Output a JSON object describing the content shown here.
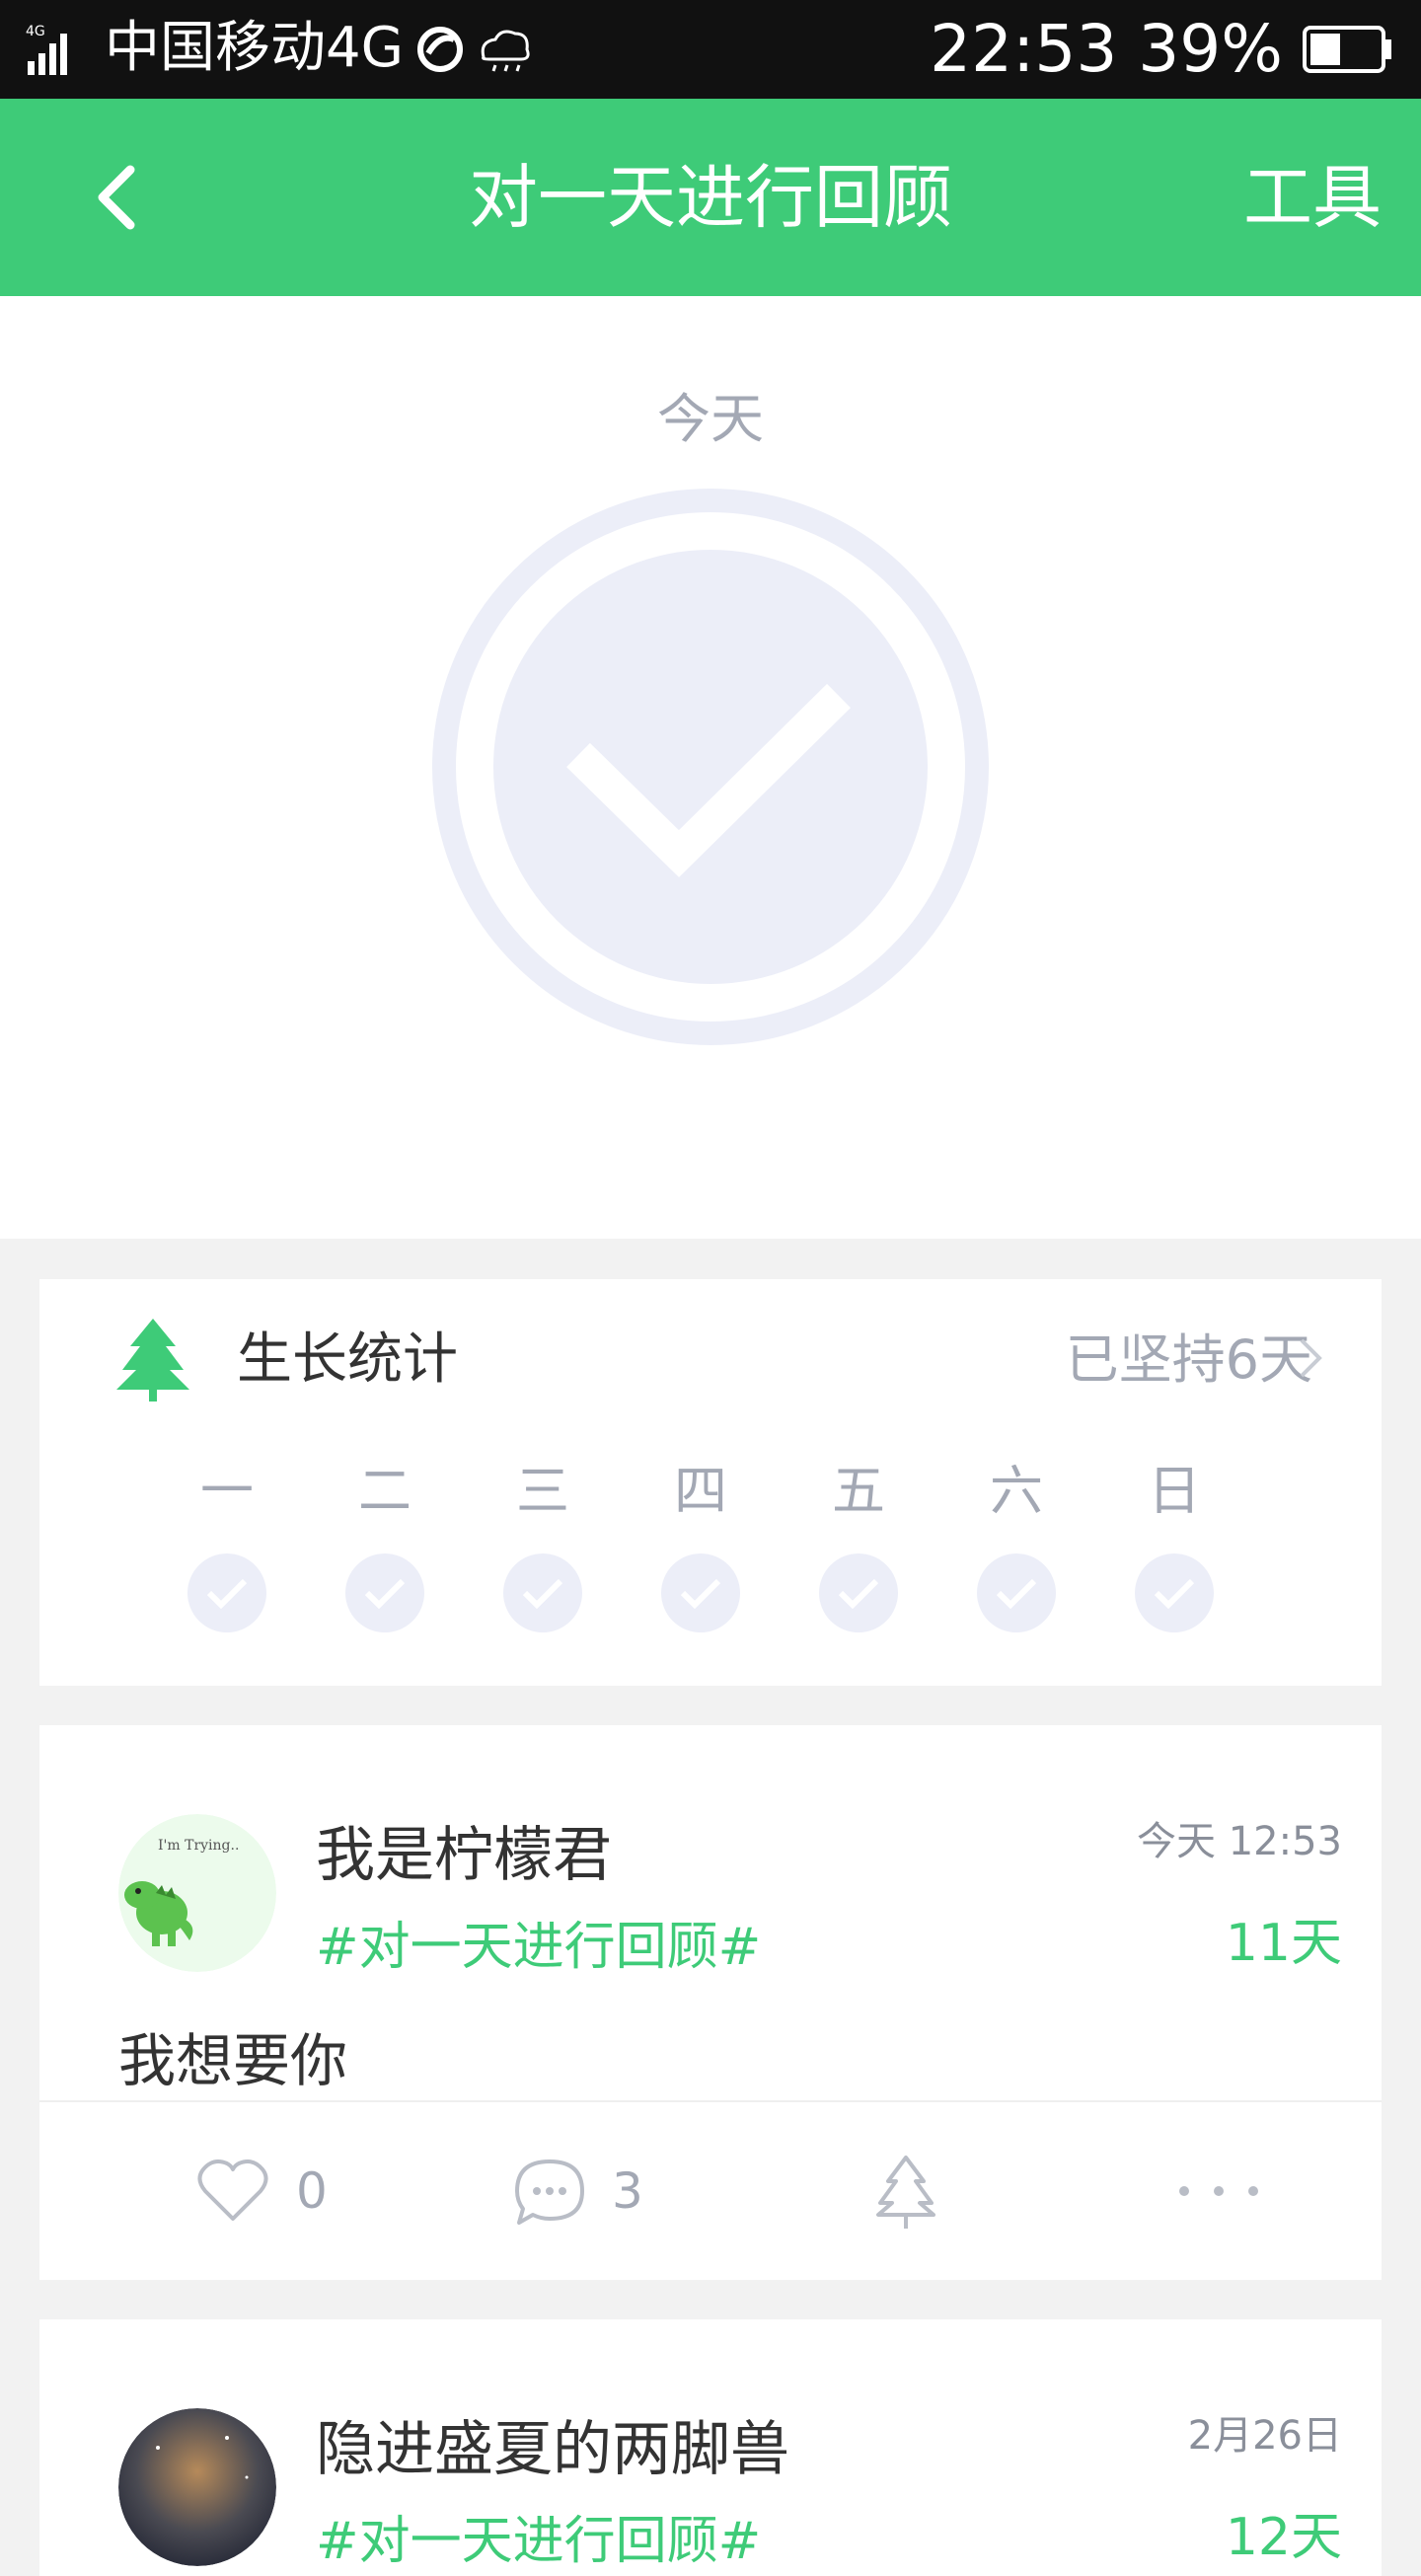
{
  "status_bar": {
    "carrier": "中国移动4G",
    "time": "22:53",
    "battery": "39%",
    "icons": [
      "signal-4g-icon",
      "network-icon",
      "rain-cloud-icon",
      "battery-icon"
    ]
  },
  "nav": {
    "back_icon": "back-arrow-icon",
    "title": "对一天进行回顾",
    "tools": "工具"
  },
  "hero": {
    "label": "今天",
    "check_icon": "check-circle-icon",
    "check_color": "#eceef8",
    "ring_color": "#eceef8"
  },
  "growth": {
    "icon": "tree-icon",
    "title": "生长统计",
    "streak": "已坚持6天",
    "days": [
      {
        "label": "一",
        "checked": true
      },
      {
        "label": "二",
        "checked": true
      },
      {
        "label": "三",
        "checked": true
      },
      {
        "label": "四",
        "checked": true
      },
      {
        "label": "五",
        "checked": true
      },
      {
        "label": "六",
        "checked": true
      },
      {
        "label": "日",
        "checked": true
      }
    ]
  },
  "posts": [
    {
      "name": "我是柠檬君",
      "tag": "#对一天进行回顾#",
      "time": "今天 12:53",
      "days": "11天",
      "text": "我想要你",
      "avatar_text": "I'm Trying..",
      "likes": "0",
      "comments": "3"
    },
    {
      "name": "隐进盛夏的两脚兽",
      "tag": "#对一天进行回顾#",
      "time": "2月26日",
      "days": "12天"
    }
  ],
  "colors": {
    "accent": "#3ecb78",
    "status_bar": "#111111",
    "muted": "#a3a8b4",
    "background": "#f2f2f2"
  }
}
